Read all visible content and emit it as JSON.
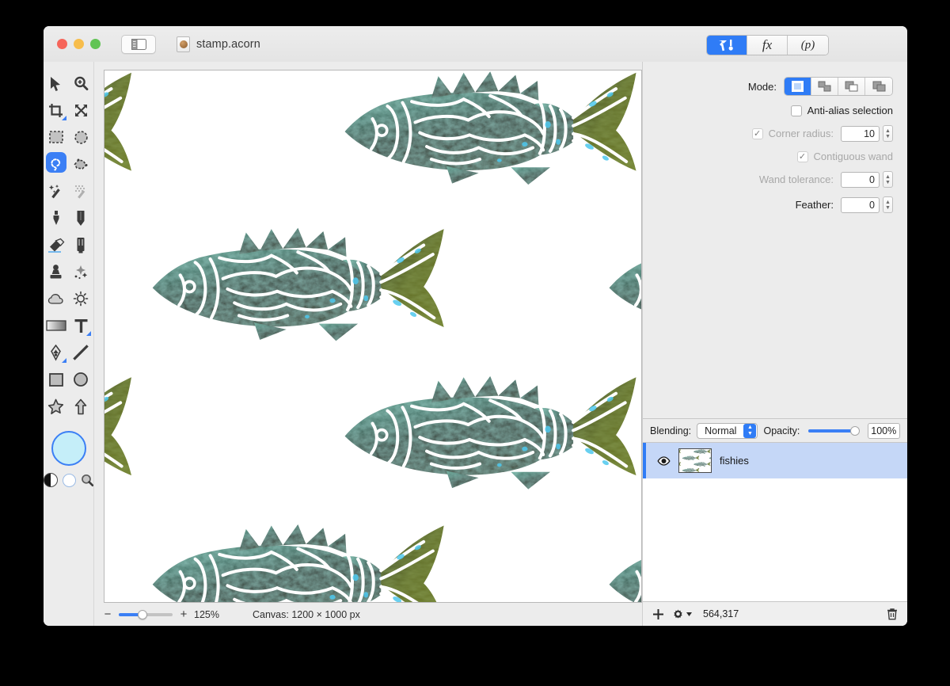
{
  "window": {
    "title": "stamp.acorn",
    "traffic_lights": [
      "close",
      "minimize",
      "zoom"
    ],
    "sidebar_toggle_icon": "sidebar-toggle-icon",
    "document_icon": "acorn-document-icon"
  },
  "inspector_tabs": [
    {
      "id": "tool-options",
      "icon": "hammer-tool-icon",
      "label": "",
      "active": true
    },
    {
      "id": "filters",
      "icon": "fx-icon",
      "label": "fx",
      "active": false
    },
    {
      "id": "presets",
      "icon": "presets-icon",
      "label": "(p)",
      "active": false
    }
  ],
  "tools": [
    {
      "name": "move-tool",
      "icon": "arrow-cursor-icon",
      "active": false
    },
    {
      "name": "zoom-tool",
      "icon": "magnifier-plus-icon",
      "active": false
    },
    {
      "name": "crop-tool",
      "icon": "crop-icon",
      "active": false,
      "corner": true
    },
    {
      "name": "transform-tool",
      "icon": "move-arrows-icon",
      "active": false
    },
    {
      "name": "rectangular-selection-tool",
      "icon": "dashed-rectangle-icon",
      "active": false
    },
    {
      "name": "elliptical-selection-tool",
      "icon": "dashed-ellipse-icon",
      "active": false
    },
    {
      "name": "lasso-selection-tool",
      "icon": "lasso-icon",
      "active": true
    },
    {
      "name": "polygon-selection-tool",
      "icon": "polygon-lasso-icon",
      "active": false
    },
    {
      "name": "magic-wand-tool",
      "icon": "magic-wand-icon",
      "active": false
    },
    {
      "name": "instant-alpha-tool",
      "icon": "dotted-wand-icon",
      "active": false
    },
    {
      "name": "brush-tool",
      "icon": "paintbrush-icon",
      "active": false
    },
    {
      "name": "pencil-tool",
      "icon": "pencil-icon",
      "active": false
    },
    {
      "name": "eraser-tool",
      "icon": "eraser-icon",
      "active": false
    },
    {
      "name": "marker-tool",
      "icon": "marker-icon",
      "active": false
    },
    {
      "name": "clone-stamp-tool",
      "icon": "rubber-stamp-icon",
      "active": false
    },
    {
      "name": "smudge-tool",
      "icon": "sparkle-smudge-icon",
      "active": false
    },
    {
      "name": "blur-tool",
      "icon": "cloud-icon",
      "active": false
    },
    {
      "name": "dodge-tool",
      "icon": "sun-icon",
      "active": false
    },
    {
      "name": "gradient-tool",
      "icon": "gradient-icon",
      "active": false
    },
    {
      "name": "text-tool",
      "icon": "text-t-icon",
      "active": false,
      "corner": true
    },
    {
      "name": "bezier-pen-tool",
      "icon": "fountain-pen-icon",
      "active": false,
      "corner": true
    },
    {
      "name": "line-tool",
      "icon": "line-icon",
      "active": false
    },
    {
      "name": "rectangle-shape-tool",
      "icon": "rectangle-icon",
      "active": false
    },
    {
      "name": "ellipse-shape-tool",
      "icon": "ellipse-icon",
      "active": false
    },
    {
      "name": "star-shape-tool",
      "icon": "star-icon",
      "active": false
    },
    {
      "name": "arrow-shape-tool",
      "icon": "arrow-up-icon",
      "active": false
    }
  ],
  "color": {
    "foreground_hex": "#c5eef9",
    "foreground_ring_hex": "#3b7ff5",
    "background_hex": "#ffffff",
    "accent_hex": "#3b7ff5"
  },
  "tool_options": {
    "mode_label": "Mode:",
    "modes": [
      {
        "name": "new-selection",
        "active": true
      },
      {
        "name": "add-to-selection",
        "active": false
      },
      {
        "name": "subtract-from-selection",
        "active": false
      },
      {
        "name": "intersect-selection",
        "active": false
      }
    ],
    "antialias": {
      "label": "Anti-alias selection",
      "checked": false,
      "enabled": true
    },
    "corner_radius": {
      "label": "Corner radius:",
      "checked": true,
      "value": "10",
      "enabled": false
    },
    "contiguous_wand": {
      "label": "Contiguous wand",
      "checked": true,
      "enabled": false
    },
    "wand_tolerance": {
      "label": "Wand tolerance:",
      "value": "0",
      "enabled": false
    },
    "feather": {
      "label": "Feather:",
      "value": "0",
      "enabled": true
    }
  },
  "layers_panel": {
    "blending_label": "Blending:",
    "blending_value": "Normal",
    "opacity_label": "Opacity:",
    "opacity_value": "100%",
    "opacity_percent": 100,
    "rows": [
      {
        "name": "fishies",
        "visible": true,
        "selected": true
      }
    ],
    "footer": {
      "add_icon": "plus-icon",
      "settings_icon": "gear-dropdown-icon",
      "selection_count": "564,317",
      "delete_icon": "trash-icon"
    }
  },
  "status_bar": {
    "zoom_minus": "−",
    "zoom_plus": "+",
    "zoom_level": "125%",
    "canvas_info": "Canvas: 1200 × 1000 px"
  },
  "artwork": {
    "description": "Repeating stencil fish pattern",
    "background_hex": "#ffffff",
    "body_dark_hex": "#3a3a28",
    "body_teal_hex": "#4f8a80",
    "body_light_hex": "#8fc4b5",
    "tail_olive_hex": "#5e6b1f",
    "spot_cyan_hex": "#49c6e8",
    "outline_hex": "#ffffff"
  }
}
